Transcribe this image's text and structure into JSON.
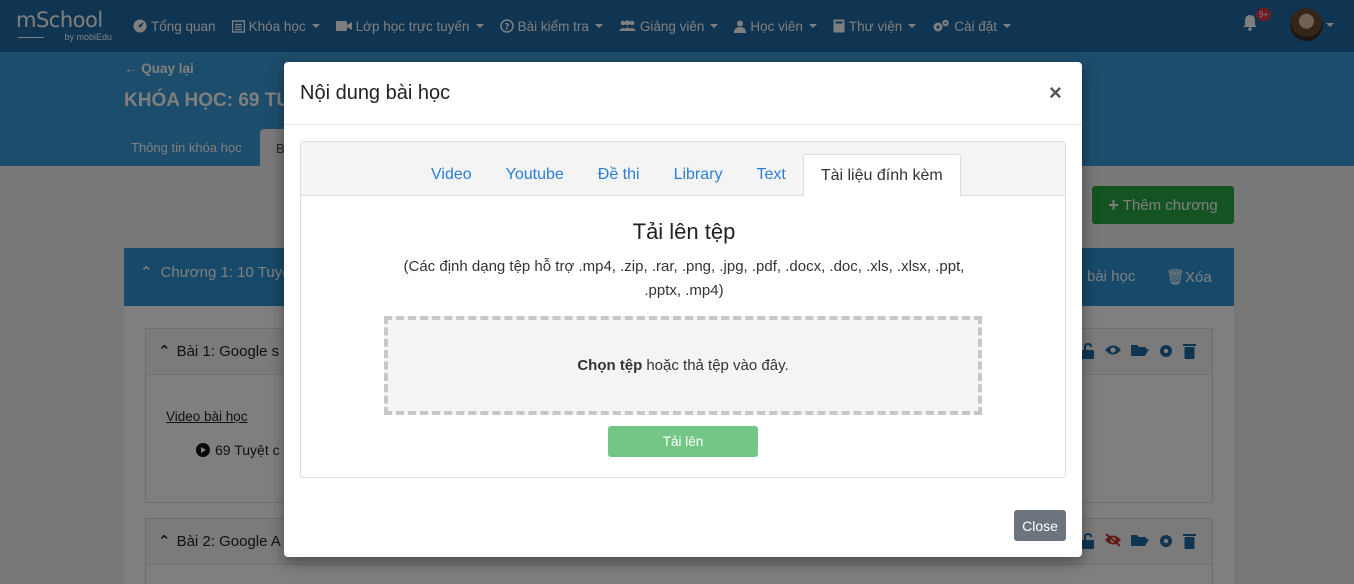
{
  "brand": {
    "logo_main": "mSchool",
    "logo_sub": "by mobiEdu"
  },
  "nav": {
    "items": [
      {
        "label": "Tổng quan",
        "icon": "dashboard-icon",
        "caret": false
      },
      {
        "label": "Khóa học",
        "icon": "list-icon",
        "caret": true
      },
      {
        "label": "Lớp học trực tuyến",
        "icon": "video-camera-icon",
        "caret": true
      },
      {
        "label": "Bài kiểm tra",
        "icon": "question-circle-icon",
        "caret": true
      },
      {
        "label": "Giảng viên",
        "icon": "users-icon",
        "caret": true
      },
      {
        "label": "Học viên",
        "icon": "user-icon",
        "caret": true
      },
      {
        "label": "Thư viện",
        "icon": "book-icon",
        "caret": true
      },
      {
        "label": "Cài đặt",
        "icon": "cogs-icon",
        "caret": true
      }
    ],
    "notification_badge": "9+"
  },
  "header": {
    "back_label": "Quay lại",
    "course_title": "KHÓA HỌC: 69 TU",
    "tab_info": "Thông tin khóa học",
    "tab_b": "B"
  },
  "content": {
    "add_chapter_label": "Thêm chương",
    "chapter_title": "Chương 1: 10 Tuyệ",
    "chapter_add_lesson": "bài học",
    "chapter_delete": "Xóa",
    "lesson1_title": "Bài 1: Google s",
    "lesson2_title": "Bài 2: Google A",
    "video_label": "Video bài học",
    "video_item": "69 Tuyệt c"
  },
  "modal": {
    "title": "Nội dung bài học",
    "close_x": "×",
    "tabs": [
      "Video",
      "Youtube",
      "Đề thi",
      "Library",
      "Text",
      "Tài liệu đính kèm"
    ],
    "active_tab": "Tài liệu đính kèm",
    "upload_title": "Tải lên tệp",
    "upload_desc": "(Các định dạng tệp hỗ trợ .mp4, .zip, .rar, .png, .jpg, .pdf, .docx, .doc, .xls, .xlsx, .ppt, .pptx, .mp4)",
    "drop_choose": "Chọn tệp",
    "drop_rest": "hoặc thả tệp vào đây.",
    "upload_button": "Tải lên",
    "close_button": "Close"
  },
  "colors": {
    "navbar": "#1f6aa5",
    "header": "#3b9ad8",
    "chapter": "#2f93d5",
    "add_button": "#28a745",
    "upload_button": "#74c687",
    "close_button": "#6c757d",
    "action_icon": "#1f6aa5",
    "hidden_icon": "#c0392b"
  }
}
